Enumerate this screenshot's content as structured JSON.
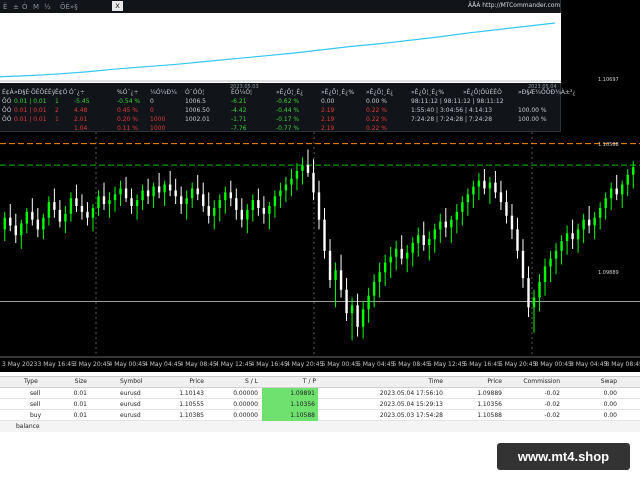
{
  "colors": {
    "chart_bg": "#000000",
    "bull_candle": "#00ff00",
    "bear_candle": "#ffffff",
    "equity_line": "#35c6f2",
    "level_orange": "#ff8c00",
    "level_green": "#00c000",
    "level_gray": "#9e9e9e",
    "green_value": "#39d139",
    "red_value": "#e03a3a",
    "tp_highlight": "#6fe16f",
    "badge_bg": "#333333"
  },
  "equity_panel": {
    "toolbar": [
      "Ë",
      "±",
      "Ó",
      "M",
      "½",
      "ÕÉ»§"
    ],
    "close_label": "x",
    "watermark": "ÂÅÀ http://MTCommander.com",
    "equity_curve": [
      0.04,
      0.06,
      0.09,
      0.13,
      0.18,
      0.22,
      0.26,
      0.31,
      0.36,
      0.41,
      0.46,
      0.52,
      0.58,
      0.63,
      0.69,
      0.75,
      0.82,
      0.88,
      0.94,
      1.0
    ],
    "date_labels": [
      "2023.05.03",
      "2023.05.04"
    ],
    "columns": [
      "É¢À",
      "»Ð§É·ÕÊÔÉÊý",
      "Ê¢Ó",
      "Ó¯¿÷",
      "%Ó¯¿÷",
      "¼Ó¼Ð¼",
      "Ó¯ÓÓ¦",
      "ÊÓ¼Ó¦",
      "»Ê¿Õ¦¸É¿",
      "»Ê¿Õ¦¸É¿%",
      "»Ê¿Õ¦¸É¿",
      "»Ê¿Õ¦¸É¿%",
      "»Ê¿Õ¦ÖÚÉÊÓ",
      "»Ð§Æ¼ÕÖÐ¾À±³¿",
      "ÊÂÄ"
    ],
    "rows": [
      {
        "symbol": "ÔÓ",
        "lots": "0.01 | 0.01",
        "count": "1",
        "profit": "-5.45",
        "pct": "-0.54 %",
        "zero": "0",
        "balance": "1006.5",
        "v1": "-6.21",
        "v2": "-0.62 %",
        "v3": "0.00",
        "v4": "0.00 %",
        "time": "98:11:12 | 98:11:12 | 98:11:12",
        "pct2": ""
      },
      {
        "symbol": "ÔÓ",
        "lots": "0.01 | 0.01",
        "count": "2",
        "profit": "4.48",
        "pct": "0.45 %",
        "zero": "0",
        "balance": "1006.50",
        "v1": "-4.42",
        "v2": "-0.44 %",
        "v3": "2.19",
        "v4": "0.22 %",
        "time": "1:55:40 | 3:04:56 | 4:14:13",
        "pct2": "100.00 %"
      },
      {
        "symbol": "ÔÓ",
        "lots": "0.01 | 0.01",
        "count": "1",
        "profit": "2.01",
        "pct": "0.20 %",
        "zero": "1000",
        "balance": "1002.01",
        "v1": "-1.71",
        "v2": "-0.17 %",
        "v3": "2.19",
        "v4": "0.22 %",
        "time": "7:24:28 | 7:24:28 | 7:24:28",
        "pct2": "100.00 %"
      },
      {
        "symbol": "",
        "lots": "",
        "count": "",
        "profit": "1.04",
        "pct": "0.11 %",
        "zero": "1000",
        "balance": "",
        "v1": "-7.76",
        "v2": "-0.77 %",
        "v3": "2.19",
        "v4": "0.22 %",
        "time": "",
        "pct2": ""
      }
    ]
  },
  "candles": [
    [
      1.1025,
      1.1034,
      1.1019,
      1.1031
    ],
    [
      1.1031,
      1.1038,
      1.1024,
      1.1027
    ],
    [
      1.1027,
      1.1033,
      1.1018,
      1.1022
    ],
    [
      1.1022,
      1.103,
      1.1015,
      1.1028
    ],
    [
      1.1028,
      1.1036,
      1.1023,
      1.1034
    ],
    [
      1.1034,
      1.1041,
      1.1027,
      1.103
    ],
    [
      1.103,
      1.1036,
      1.1021,
      1.1025
    ],
    [
      1.1025,
      1.1033,
      1.102,
      1.1031
    ],
    [
      1.1031,
      1.1042,
      1.1027,
      1.1039
    ],
    [
      1.1039,
      1.1046,
      1.1031,
      1.1035
    ],
    [
      1.1035,
      1.104,
      1.1026,
      1.1029
    ],
    [
      1.1029,
      1.1037,
      1.1023,
      1.1033
    ],
    [
      1.1033,
      1.1044,
      1.1029,
      1.1041
    ],
    [
      1.1041,
      1.1048,
      1.1034,
      1.1037
    ],
    [
      1.1037,
      1.1043,
      1.103,
      1.1034
    ],
    [
      1.1034,
      1.1039,
      1.1027,
      1.1031
    ],
    [
      1.1031,
      1.1038,
      1.1024,
      1.1036
    ],
    [
      1.1036,
      1.1045,
      1.1032,
      1.1042
    ],
    [
      1.1042,
      1.1049,
      1.1035,
      1.1038
    ],
    [
      1.1038,
      1.1044,
      1.1031,
      1.104
    ],
    [
      1.104,
      1.1047,
      1.1034,
      1.1043
    ],
    [
      1.1043,
      1.105,
      1.1037,
      1.1046
    ],
    [
      1.1046,
      1.1052,
      1.1039,
      1.1041
    ],
    [
      1.1041,
      1.1046,
      1.1033,
      1.1037
    ],
    [
      1.1037,
      1.1043,
      1.103,
      1.104
    ],
    [
      1.104,
      1.1048,
      1.1035,
      1.1045
    ],
    [
      1.1045,
      1.1051,
      1.1038,
      1.1042
    ],
    [
      1.1042,
      1.1049,
      1.1036,
      1.1047
    ],
    [
      1.1047,
      1.1054,
      1.1041,
      1.1044
    ],
    [
      1.1044,
      1.105,
      1.1037,
      1.1048
    ],
    [
      1.1048,
      1.1055,
      1.1042,
      1.1045
    ],
    [
      1.1045,
      1.1051,
      1.1038,
      1.1042
    ],
    [
      1.1042,
      1.1047,
      1.1033,
      1.1038
    ],
    [
      1.1038,
      1.1045,
      1.103,
      1.1041
    ],
    [
      1.1041,
      1.1049,
      1.1036,
      1.1046
    ],
    [
      1.1046,
      1.1053,
      1.104,
      1.1043
    ],
    [
      1.1043,
      1.1049,
      1.1034,
      1.1037
    ],
    [
      1.1037,
      1.1044,
      1.1028,
      1.1032
    ],
    [
      1.1032,
      1.104,
      1.1025,
      1.1036
    ],
    [
      1.1036,
      1.1043,
      1.1029,
      1.104
    ],
    [
      1.104,
      1.1047,
      1.1033,
      1.1044
    ],
    [
      1.1044,
      1.105,
      1.1037,
      1.1041
    ],
    [
      1.1041,
      1.1046,
      1.103,
      1.1035
    ],
    [
      1.1035,
      1.1041,
      1.1026,
      1.103
    ],
    [
      1.103,
      1.1038,
      1.1023,
      1.1035
    ],
    [
      1.1035,
      1.1043,
      1.1029,
      1.104
    ],
    [
      1.104,
      1.1046,
      1.1032,
      1.1036
    ],
    [
      1.1036,
      1.1042,
      1.1028,
      1.1033
    ],
    [
      1.1033,
      1.1039,
      1.1025,
      1.1037
    ],
    [
      1.1037,
      1.1045,
      1.1031,
      1.1042
    ],
    [
      1.1042,
      1.1049,
      1.1036,
      1.1045
    ],
    [
      1.1045,
      1.1052,
      1.1039,
      1.1048
    ],
    [
      1.1048,
      1.1056,
      1.1042,
      1.1051
    ],
    [
      1.1051,
      1.1059,
      1.1045,
      1.1055
    ],
    [
      1.1055,
      1.1062,
      1.1048,
      1.1058
    ],
    [
      1.1058,
      1.1066,
      1.1052,
      1.1054
    ],
    [
      1.1054,
      1.1061,
      1.104,
      1.1044
    ],
    [
      1.1044,
      1.105,
      1.1025,
      1.103
    ],
    [
      1.103,
      1.1036,
      1.101,
      1.1014
    ],
    [
      1.1014,
      1.102,
      1.0995,
      1.0999
    ],
    [
      1.0999,
      1.1008,
      1.0985,
      1.1004
    ],
    [
      1.1004,
      1.1012,
      1.099,
      1.0994
    ],
    [
      1.0994,
      1.1,
      1.0978,
      1.0982
    ],
    [
      1.0982,
      1.099,
      1.0968,
      1.0986
    ],
    [
      1.0986,
      1.0992,
      1.097,
      1.0975
    ],
    [
      1.0975,
      1.0988,
      1.0969,
      1.0984
    ],
    [
      1.0984,
      1.0995,
      1.0977,
      1.0991
    ],
    [
      1.0991,
      1.1002,
      1.0985,
      1.0998
    ],
    [
      1.0998,
      1.1008,
      1.099,
      1.1003
    ],
    [
      1.1003,
      1.1012,
      1.0996,
      1.1008
    ],
    [
      1.1008,
      1.1016,
      1.1,
      1.1011
    ],
    [
      1.1011,
      1.1019,
      1.1004,
      1.1015
    ],
    [
      1.1015,
      1.1022,
      1.1007,
      1.101
    ],
    [
      1.101,
      1.1017,
      1.1003,
      1.1013
    ],
    [
      1.1013,
      1.1021,
      1.1006,
      1.1018
    ],
    [
      1.1018,
      1.1026,
      1.1011,
      1.1022
    ],
    [
      1.1022,
      1.1029,
      1.1014,
      1.1017
    ],
    [
      1.1017,
      1.1024,
      1.1009,
      1.102
    ],
    [
      1.102,
      1.1028,
      1.1013,
      1.1025
    ],
    [
      1.1025,
      1.1033,
      1.1018,
      1.1029
    ],
    [
      1.1029,
      1.1036,
      1.1021,
      1.1026
    ],
    [
      1.1026,
      1.1032,
      1.1018,
      1.103
    ],
    [
      1.103,
      1.1038,
      1.1023,
      1.1034
    ],
    [
      1.1034,
      1.1042,
      1.1027,
      1.1039
    ],
    [
      1.1039,
      1.1046,
      1.1032,
      1.1043
    ],
    [
      1.1043,
      1.105,
      1.1036,
      1.1047
    ],
    [
      1.1047,
      1.1054,
      1.104,
      1.105
    ],
    [
      1.105,
      1.1056,
      1.1043,
      1.1046
    ],
    [
      1.1046,
      1.1052,
      1.1038,
      1.1049
    ],
    [
      1.1049,
      1.1055,
      1.1041,
      1.1044
    ],
    [
      1.1044,
      1.105,
      1.1035,
      1.1039
    ],
    [
      1.1039,
      1.1045,
      1.1028,
      1.1032
    ],
    [
      1.1032,
      1.1038,
      1.102,
      1.1025
    ],
    [
      1.1025,
      1.1031,
      1.101,
      1.1014
    ],
    [
      1.1014,
      1.102,
      1.0995,
      1.1
    ],
    [
      1.1,
      1.1006,
      1.098,
      1.0985
    ],
    [
      1.0985,
      1.0994,
      1.0972,
      1.099
    ],
    [
      1.099,
      1.1002,
      1.0983,
      1.0998
    ],
    [
      1.0998,
      1.101,
      1.0991,
      1.1006
    ],
    [
      1.1006,
      1.1014,
      1.0998,
      1.101
    ],
    [
      1.101,
      1.1018,
      1.1002,
      1.1014
    ],
    [
      1.1014,
      1.1022,
      1.1007,
      1.1019
    ],
    [
      1.1019,
      1.1027,
      1.1012,
      1.1023
    ],
    [
      1.1023,
      1.103,
      1.1015,
      1.102
    ],
    [
      1.102,
      1.1028,
      1.1013,
      1.1025
    ],
    [
      1.1025,
      1.1033,
      1.1018,
      1.103
    ],
    [
      1.103,
      1.1037,
      1.1023,
      1.1027
    ],
    [
      1.1027,
      1.1034,
      1.102,
      1.1031
    ],
    [
      1.1031,
      1.1039,
      1.1025,
      1.1036
    ],
    [
      1.1036,
      1.1044,
      1.103,
      1.1041
    ],
    [
      1.1041,
      1.1049,
      1.1035,
      1.1046
    ],
    [
      1.1046,
      1.1053,
      1.104,
      1.1043
    ],
    [
      1.1043,
      1.105,
      1.1036,
      1.1048
    ],
    [
      1.1048,
      1.1056,
      1.1042,
      1.1053
    ],
    [
      1.1053,
      1.106,
      1.1046,
      1.1057
    ]
  ],
  "price_range": [
    1.096,
    1.1075
  ],
  "levels": [
    {
      "name": "orange-level-line",
      "price": 1.1069,
      "color": "#ff8c00",
      "dash": "6 3"
    },
    {
      "name": "green-level-line",
      "price": 1.1058,
      "color": "#00c000",
      "dash": "6 3"
    },
    {
      "name": "gray-level-line",
      "price": 1.0988,
      "color": "#9e9e9e",
      "dash": ""
    }
  ],
  "price_labels": [
    "1.10697",
    "1.10588",
    "1.09889"
  ],
  "time_axis": [
    "3 May 2023",
    "3 May 16:45",
    "3 May 20:45",
    "4 May 00:45",
    "4 May 04:45",
    "4 May 08:45",
    "4 May 12:45",
    "4 May 16:45",
    "4 May 20:45",
    "5 May 00:45",
    "5 May 04:45",
    "5 May 08:45",
    "5 May 12:45",
    "5 May 16:45",
    "5 May 20:45",
    "8 May 00:45",
    "8 May 04:45",
    "8 May 08:45"
  ],
  "trade_table": {
    "columns": [
      "Type",
      "Size",
      "Symbol",
      "Price",
      "S / L",
      "T / P",
      "Time",
      "Price",
      "Commission",
      "Swap"
    ],
    "rows": [
      {
        "type": "sell",
        "size": "0.01",
        "symbol": "eurusd",
        "price": "1.10143",
        "sl": "0.00000",
        "tp": "1.09891",
        "time": "2023.05.04 17:56:10",
        "close_price": "1.09889",
        "commission": "-0.02",
        "swap": "0.00"
      },
      {
        "type": "sell",
        "size": "0.01",
        "symbol": "eurusd",
        "price": "1.10555",
        "sl": "0.00000",
        "tp": "1.10356",
        "time": "2023.05.04 15:29:13",
        "close_price": "1.10356",
        "commission": "-0.02",
        "swap": "0.00"
      },
      {
        "type": "buy",
        "size": "0.01",
        "symbol": "eurusd",
        "price": "1.10385",
        "sl": "0.00000",
        "tp": "1.10588",
        "time": "2023.05.03 17:54:28",
        "close_price": "1.10588",
        "commission": "-0.02",
        "swap": "0.00"
      }
    ],
    "balance_label": "balance"
  },
  "brand_badge": "www.mt4.shop"
}
